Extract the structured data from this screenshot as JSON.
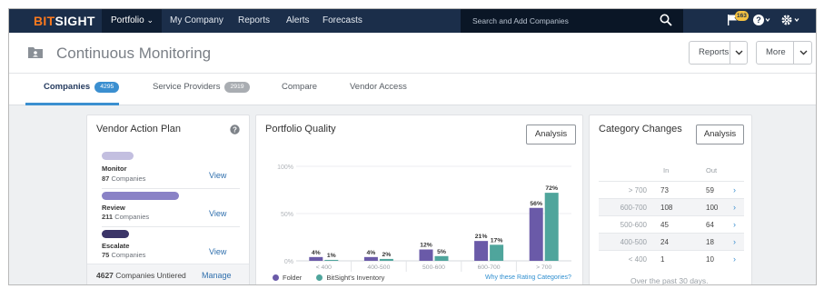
{
  "topbar": {
    "logo_part1": "BIT",
    "logo_part2": "SIGHT",
    "nav": [
      {
        "label": "Portfolio",
        "caret": "⌄"
      },
      {
        "label": "My Company"
      },
      {
        "label": "Reports"
      },
      {
        "label": "Alerts"
      },
      {
        "label": "Forecasts"
      }
    ],
    "search_placeholder": "Search and Add Companies",
    "notification_count": "163",
    "icons": [
      "search-icon",
      "flag-icon",
      "help-icon",
      "gear-icon"
    ]
  },
  "header": {
    "title": "Continuous Monitoring",
    "reports_button": "Reports",
    "more_button": "More"
  },
  "tabs": [
    {
      "label": "Companies",
      "count": "4295",
      "active": true
    },
    {
      "label": "Service Providers",
      "count": "2919",
      "active": false
    },
    {
      "label": "Compare",
      "active": false
    },
    {
      "label": "Vendor Access",
      "active": false
    }
  ],
  "vendor_action_plan": {
    "title": "Vendor Action Plan",
    "items": [
      {
        "name": "Monitor",
        "count": "87",
        "suffix": "Companies",
        "link": "View",
        "color": "#c3bfe0",
        "fill": 0.27
      },
      {
        "name": "Review",
        "count": "211",
        "suffix": "Companies",
        "link": "View",
        "color": "#8a82c6",
        "fill": 0.65
      },
      {
        "name": "Escalate",
        "count": "75",
        "suffix": "Companies",
        "link": "View",
        "color": "#3b3568",
        "fill": 0.23
      }
    ],
    "untiered_count": "4627",
    "untiered_text": "Companies Untiered",
    "manage_link": "Manage"
  },
  "portfolio_quality": {
    "title": "Portfolio Quality",
    "analysis_button": "Analysis",
    "legend": [
      {
        "name": "Folder",
        "color": "#6a5aa8"
      },
      {
        "name": "BitSight's Inventory",
        "color": "#4fa59c"
      }
    ],
    "why_link": "Why these Rating Categories?"
  },
  "chart_data": {
    "type": "bar",
    "categories": [
      "< 400",
      "400-500",
      "500-600",
      "600-700",
      "> 700"
    ],
    "series": [
      {
        "name": "Folder",
        "values": [
          4,
          4,
          12,
          21,
          56
        ]
      },
      {
        "name": "BitSight's Inventory",
        "values": [
          1,
          2,
          5,
          17,
          72
        ]
      }
    ],
    "data_labels": [
      [
        "4%",
        "1%"
      ],
      [
        "4%",
        "2%"
      ],
      [
        "12%",
        "5%"
      ],
      [
        "21%",
        "17%"
      ],
      [
        "56%",
        "72%"
      ]
    ],
    "yticks": [
      "100%",
      "50%",
      "0%"
    ],
    "ylim": [
      0,
      100
    ],
    "grid": true
  },
  "category_changes": {
    "title": "Category Changes",
    "analysis_button": "Analysis",
    "col_in": "In",
    "col_out": "Out",
    "rows": [
      {
        "label": "> 700",
        "in": "73",
        "out": "59"
      },
      {
        "label": "600-700",
        "in": "108",
        "out": "100"
      },
      {
        "label": "500-600",
        "in": "45",
        "out": "64"
      },
      {
        "label": "400-500",
        "in": "24",
        "out": "18"
      },
      {
        "label": "< 400",
        "in": "1",
        "out": "10"
      }
    ],
    "arrow": "›",
    "footer": "Over the past 30 days."
  },
  "colors": {
    "nav_bg": "#1b2e4a",
    "accent": "#3b8fd0",
    "badge_companies": "#3b8fd0",
    "badge_providers": "#a9adb2"
  }
}
